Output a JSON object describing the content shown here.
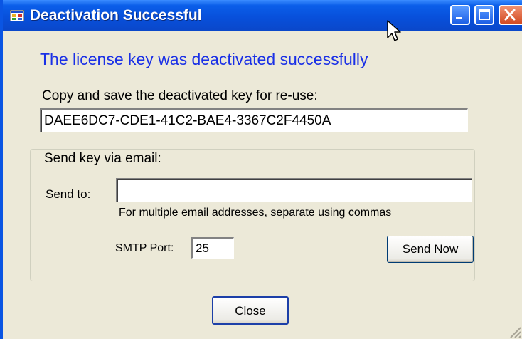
{
  "window": {
    "title": "Deactivation Successful",
    "title_color": "#ffffff",
    "titlebar_color": "#0a5ee9",
    "icons": [
      "app-icon",
      "minimize-icon",
      "maximize-icon",
      "close-icon",
      "cursor-icon"
    ]
  },
  "headline": {
    "text": "The license key was deactivated successfully",
    "color": "#1a30e6"
  },
  "copy_section": {
    "label": "Copy and save the deactivated key for re-use:",
    "key_value": "DAEE6DC7-CDE1-41C2-BAE4-3367C2F4450A"
  },
  "email_group": {
    "legend": "Send key via email:",
    "send_to_label": "Send to:",
    "send_to_value": "",
    "hint": "For multiple email addresses, separate using commas",
    "smtp_port_label": "SMTP Port:",
    "smtp_port_value": "25",
    "send_button": "Send Now"
  },
  "footer": {
    "close_button": "Close"
  }
}
